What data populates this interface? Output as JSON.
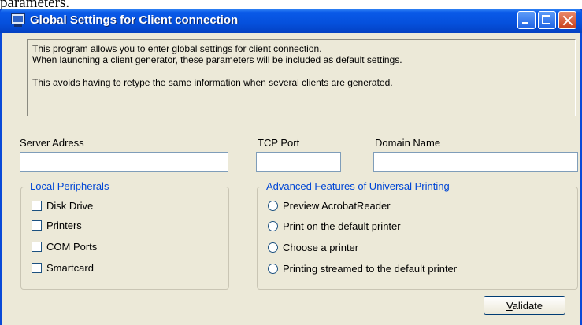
{
  "background_text": "parameters.",
  "window": {
    "title": "Global Settings for Client connection"
  },
  "info": {
    "line1": "This program allows you to enter global settings for client connection.",
    "line2": "When launching a client generator, these parameters will be included as default settings.",
    "line3": "This avoids having to retype the same information when several clients are generated."
  },
  "fields": {
    "server_label": "Server Adress",
    "server_value": "",
    "port_label": "TCP Port",
    "port_value": "",
    "domain_label": "Domain Name",
    "domain_value": ""
  },
  "peripherals": {
    "legend": "Local Peripherals",
    "items": [
      {
        "label": "Disk Drive",
        "checked": false
      },
      {
        "label": "Printers",
        "checked": false
      },
      {
        "label": "COM Ports",
        "checked": false
      },
      {
        "label": "Smartcard",
        "checked": false
      }
    ]
  },
  "printing": {
    "legend": "Advanced Features of Universal Printing",
    "options": [
      {
        "label": "Preview AcrobatReader",
        "selected": false
      },
      {
        "label": "Print on the default printer",
        "selected": false
      },
      {
        "label": "Choose a printer",
        "selected": false
      },
      {
        "label": "Printing streamed to the default printer",
        "selected": false
      }
    ]
  },
  "validate_button": {
    "accel": "V",
    "rest": "alidate"
  }
}
